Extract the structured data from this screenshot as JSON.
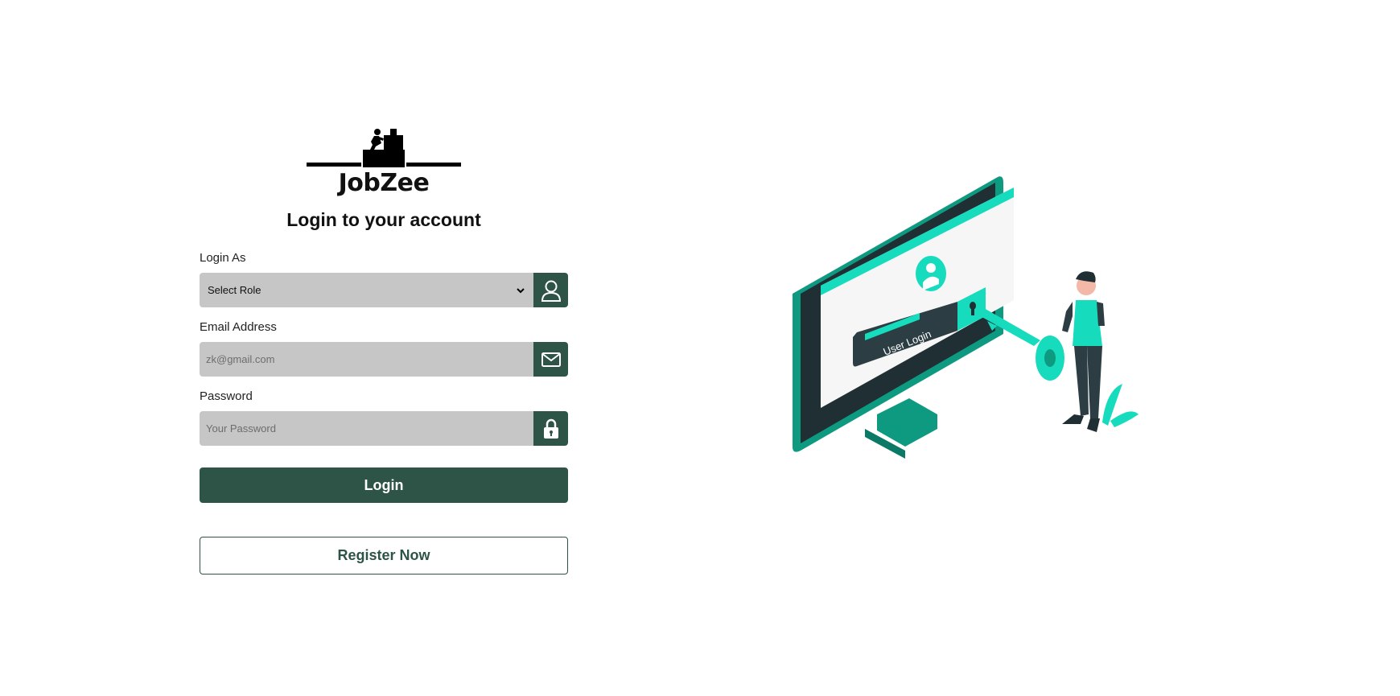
{
  "brand": {
    "name": "JobZee"
  },
  "heading": "Login to your account",
  "form": {
    "role": {
      "label": "Login As",
      "value": "Select Role",
      "icon": "user-icon"
    },
    "email": {
      "label": "Email Address",
      "placeholder": "zk@gmail.com",
      "icon": "envelope-icon"
    },
    "password": {
      "label": "Password",
      "placeholder": "Your Password",
      "icon": "lock-icon"
    },
    "login_label": "Login",
    "register_label": "Register Now"
  },
  "illustration": {
    "screen_text": "User Login"
  },
  "colors": {
    "primary": "#2d5447",
    "input_bg": "#c6c6c6",
    "accent": "#16dcbd",
    "accent_dark": "#0e9a80"
  }
}
